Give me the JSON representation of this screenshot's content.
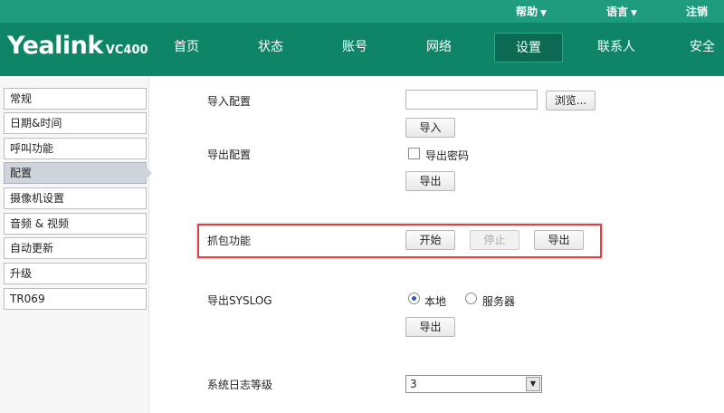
{
  "topbar": {
    "help": "帮助",
    "language": "语言",
    "logout": "注销"
  },
  "logo": {
    "brand": "Yealink",
    "model": "VC400"
  },
  "nav": {
    "tabs": [
      "首页",
      "状态",
      "账号",
      "网络",
      "设置",
      "联系人",
      "安全"
    ],
    "active": "设置"
  },
  "sidebar": {
    "items": [
      "常规",
      "日期&时间",
      "呼叫功能",
      "配置",
      "摄像机设置",
      "音频 & 视频",
      "自动更新",
      "升级",
      "TR069"
    ],
    "active": "配置"
  },
  "content": {
    "import_config": {
      "label": "导入配置",
      "file_value": "",
      "browse": "浏览...",
      "import_button": "导入"
    },
    "export_config": {
      "label": "导出配置",
      "export_password_label": "导出密码",
      "export_password_checked": false,
      "export_button": "导出"
    },
    "packet_capture": {
      "label": "抓包功能",
      "start": "开始",
      "stop": "停止",
      "export": "导出"
    },
    "export_syslog": {
      "label": "导出SYSLOG",
      "option_local": "本地",
      "option_server": "服务器",
      "selected": "本地",
      "export_button": "导出"
    },
    "log_level": {
      "label": "系统日志等级",
      "value": "3"
    }
  }
}
